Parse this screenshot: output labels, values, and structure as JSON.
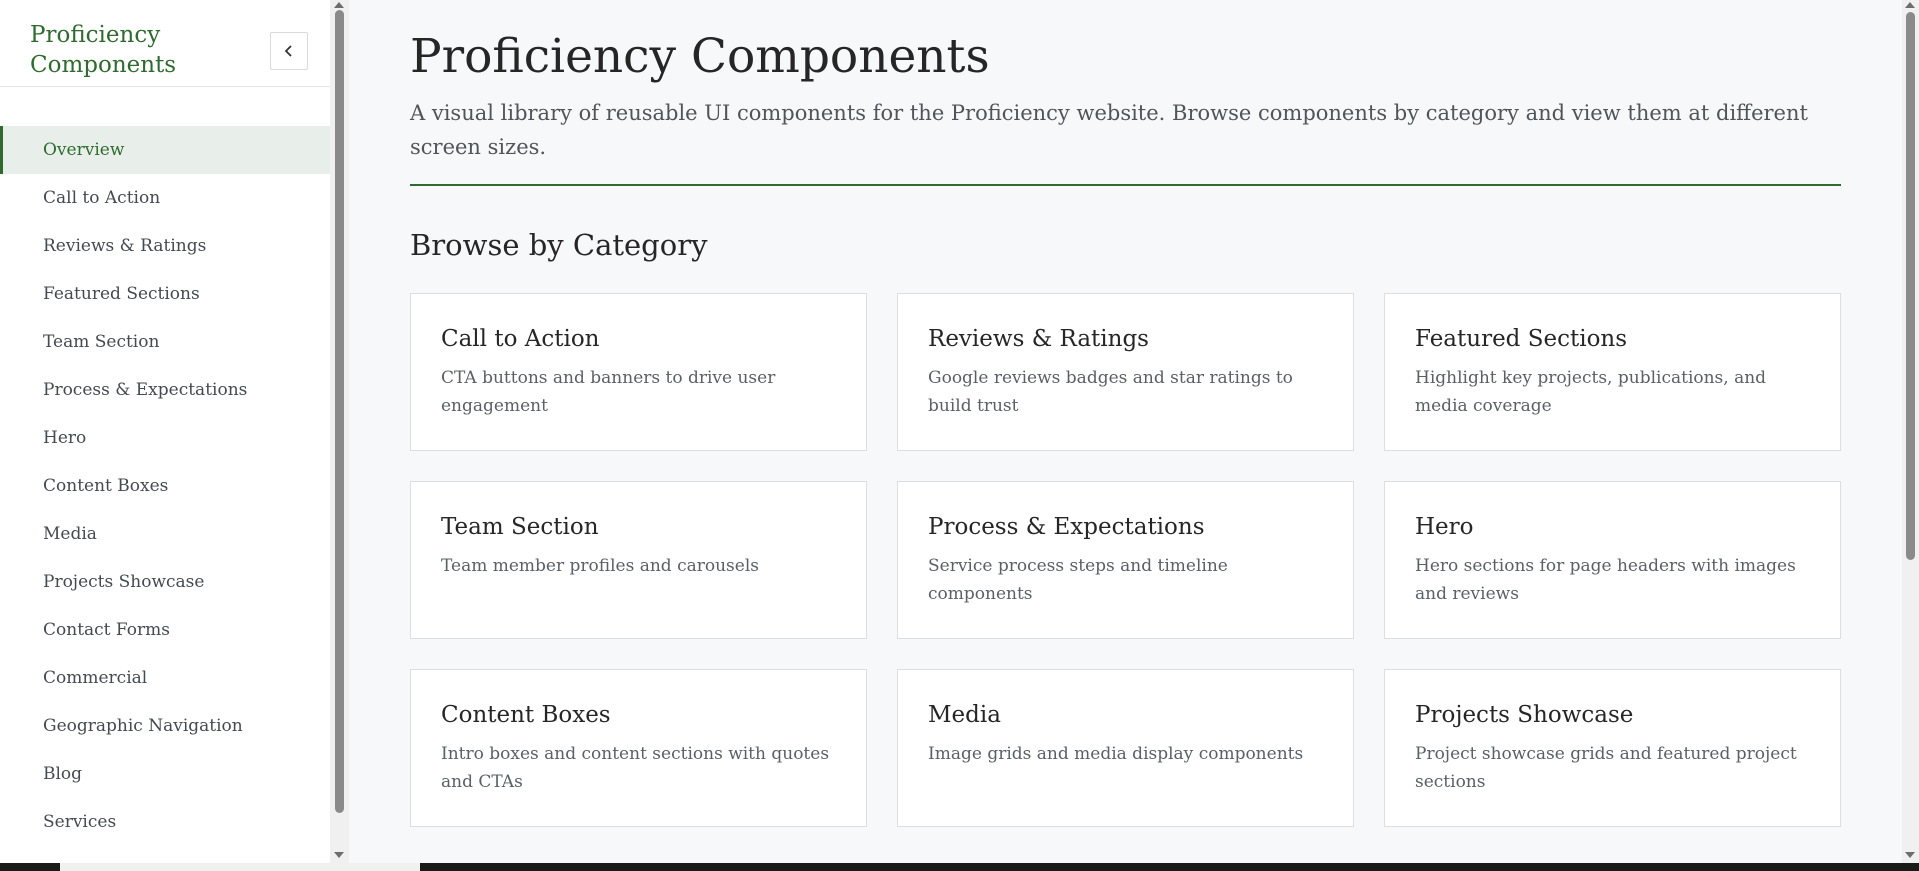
{
  "sidebar": {
    "brand": "Proficiency Components",
    "collapse_icon": "chevron-left-icon",
    "items": [
      {
        "label": "Overview",
        "active": true
      },
      {
        "label": "Call to Action",
        "active": false
      },
      {
        "label": "Reviews & Ratings",
        "active": false
      },
      {
        "label": "Featured Sections",
        "active": false
      },
      {
        "label": "Team Section",
        "active": false
      },
      {
        "label": "Process & Expectations",
        "active": false
      },
      {
        "label": "Hero",
        "active": false
      },
      {
        "label": "Content Boxes",
        "active": false
      },
      {
        "label": "Media",
        "active": false
      },
      {
        "label": "Projects Showcase",
        "active": false
      },
      {
        "label": "Contact Forms",
        "active": false
      },
      {
        "label": "Commercial",
        "active": false
      },
      {
        "label": "Geographic Navigation",
        "active": false
      },
      {
        "label": "Blog",
        "active": false
      },
      {
        "label": "Services",
        "active": false
      }
    ]
  },
  "main": {
    "title": "Proficiency Components",
    "description": "A visual library of reusable UI components for the Proficiency website. Browse components by category and view them at different screen sizes.",
    "section_title": "Browse by Category",
    "categories": [
      {
        "title": "Call to Action",
        "description": "CTA buttons and banners to drive user engagement"
      },
      {
        "title": "Reviews & Ratings",
        "description": "Google reviews badges and star ratings to build trust"
      },
      {
        "title": "Featured Sections",
        "description": "Highlight key projects, publications, and media coverage"
      },
      {
        "title": "Team Section",
        "description": "Team member profiles and carousels"
      },
      {
        "title": "Process & Expectations",
        "description": "Service process steps and timeline components"
      },
      {
        "title": "Hero",
        "description": "Hero sections for page headers with images and reviews"
      },
      {
        "title": "Content Boxes",
        "description": "Intro boxes and content sections with quotes and CTAs"
      },
      {
        "title": "Media",
        "description": "Image grids and media display components"
      },
      {
        "title": "Projects Showcase",
        "description": "Project showcase grids and featured project sections"
      }
    ]
  },
  "colors": {
    "accent": "#2f6b2f",
    "active_bg": "#e8eee9",
    "page_bg": "#f7f8f9"
  }
}
